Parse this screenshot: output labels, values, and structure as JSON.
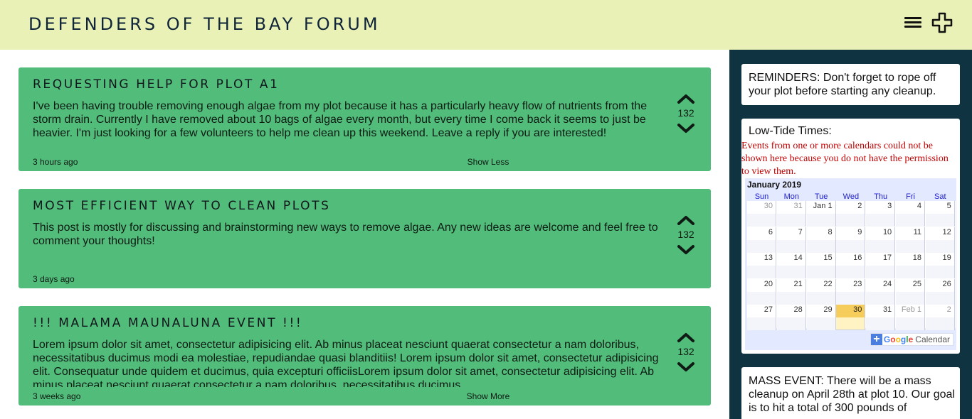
{
  "header": {
    "title": "DEFENDERS OF THE BAY FORUM",
    "menu_icon": "hamburger-menu-icon",
    "add_icon": "plus-outline-icon"
  },
  "posts": [
    {
      "title": "REQUESTING HELP FOR PLOT A1",
      "body": "I've been having trouble removing enough algae from my plot because it has a particularly heavy flow of nutrients from the storm drain. Currently I have removed about 10 bags of algae every month, but every time I come back it seems to just be heavier. I'm just looking for a few volunteers to help me clean up this weekend. Leave a reply if you are interested!",
      "votes": "132",
      "time": "3 hours ago",
      "toggle": "Show Less"
    },
    {
      "title": "MOST EFFICIENT WAY TO CLEAN PLOTS",
      "body": "This post is mostly for discussing and brainstorming new ways to remove algae. Any new ideas are welcome and feel free to comment your thoughts!",
      "votes": "132",
      "time": "3 days ago",
      "toggle": ""
    },
    {
      "title": "!!! MALAMA MAUNALUNA EVENT !!!",
      "body": "Lorem ipsum dolor sit amet, consectetur adipisicing elit. Ab minus placeat nesciunt quaerat consectetur a nam doloribus, necessitatibus ducimus modi ea molestiae, repudiandae quasi blanditiis! Lorem ipsum dolor sit amet, consectetur adipisicing elit. Consequatur unde quidem et ducimus, quia excepturi officiisLorem ipsum dolor sit amet, consectetur adipisicing elit. Ab minus placeat nesciunt quaerat consectetur a nam doloribus, necessitatibus ducimus",
      "votes": "132",
      "time": "3 weeks ago",
      "toggle": "Show More"
    }
  ],
  "sidebar": {
    "reminders": "REMINDERS: Don't forget to rope off your plot before starting any cleanup.",
    "lowtide_title": "Low-Tide Times:",
    "calendar_error": "Events from one or more calendars could not be shown here because you do not have the permission to view them.",
    "calendar": {
      "month": "January 2019",
      "weekdays": [
        "Sun",
        "Mon",
        "Tue",
        "Wed",
        "Thu",
        "Fri",
        "Sat"
      ],
      "weeks": [
        [
          "30",
          "31",
          "Jan 1",
          "2",
          "3",
          "4",
          "5"
        ],
        [
          "6",
          "7",
          "8",
          "9",
          "10",
          "11",
          "12"
        ],
        [
          "13",
          "14",
          "15",
          "16",
          "17",
          "18",
          "19"
        ],
        [
          "20",
          "21",
          "22",
          "23",
          "24",
          "25",
          "26"
        ],
        [
          "27",
          "28",
          "29",
          "30",
          "31",
          "Feb 1",
          "2"
        ]
      ],
      "today": "30",
      "google_logo": "Google",
      "google_label": "Calendar",
      "accent": "#f6cd5a"
    },
    "mass_event": "MASS EVENT: There will be a mass cleanup on April 28th at plot 10. Our goal is to hit a total of 300 pounds of"
  },
  "colors": {
    "header_bg": "#e9f1b7",
    "post_bg": "#52bd7b",
    "sidebar_bg": "#0f3340"
  }
}
